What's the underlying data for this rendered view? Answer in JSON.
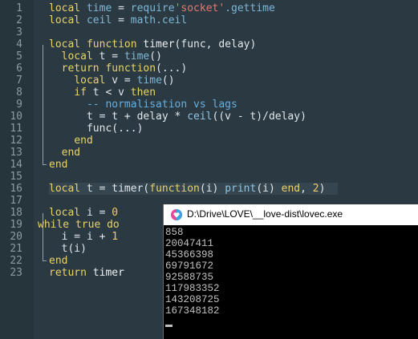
{
  "editor": {
    "line_numbers": [
      "1",
      "2",
      "3",
      "4",
      "5",
      "6",
      "7",
      "8",
      "9",
      "10",
      "11",
      "12",
      "13",
      "14",
      "15",
      "16",
      "17",
      "18",
      "19",
      "20",
      "21",
      "22",
      "23"
    ],
    "line1": {
      "a": "local",
      "b": "time",
      "c": "=",
      "d": "require",
      "e": "'socket'",
      "f": ".gettime"
    },
    "line2": {
      "a": "local",
      "b": "ceil",
      "c": "=",
      "d": "math.ceil"
    },
    "line4": {
      "a": "local function",
      "b": "timer",
      "c": "(func, delay)"
    },
    "line5": {
      "a": "local",
      "b": "t",
      "c": "=",
      "d": "time",
      "e": "()"
    },
    "line6": {
      "a": "return",
      "b": "function",
      "c": "(...)"
    },
    "line7": {
      "a": "local",
      "b": "v",
      "c": "=",
      "d": "time",
      "e": "()"
    },
    "line8": {
      "a": "if",
      "b": "t < v",
      "c": "then"
    },
    "line9": {
      "a": "-- normalisation vs lags"
    },
    "line10": {
      "a": "t = t + delay *",
      "b": "ceil",
      "c": "((v - t)/delay)"
    },
    "line11": {
      "a": "func(...)"
    },
    "line12": {
      "a": "end"
    },
    "line13": {
      "a": "end"
    },
    "line14": {
      "a": "end"
    },
    "line16": {
      "a": "local",
      "b": "t = timer(",
      "c": "function",
      "d": "(i)",
      "e": "print",
      "f": "(i)",
      "g": "end",
      "h": ",",
      "i": "2",
      "j": ")"
    },
    "line18": {
      "a": "local",
      "b": "i =",
      "c": "0"
    },
    "line19": {
      "a": "while true do"
    },
    "line20": {
      "a": "i = i +",
      "b": "1"
    },
    "line21": {
      "a": "t(i)"
    },
    "line22": {
      "a": "end"
    },
    "line23": {
      "a": "return",
      "b": "timer"
    }
  },
  "console": {
    "title": "D:\\Drive\\LOVE\\__love-dist\\lovec.exe",
    "icon": "love-heart-icon",
    "output": [
      "858",
      "20047411",
      "45366398",
      "69791672",
      "92588735",
      "117983352",
      "143208725",
      "167348182"
    ]
  },
  "colors": {
    "editor_bg": "#2b3a42",
    "keyword": "#e8d26a",
    "string": "#e07a6b",
    "comment": "#67aee0"
  }
}
